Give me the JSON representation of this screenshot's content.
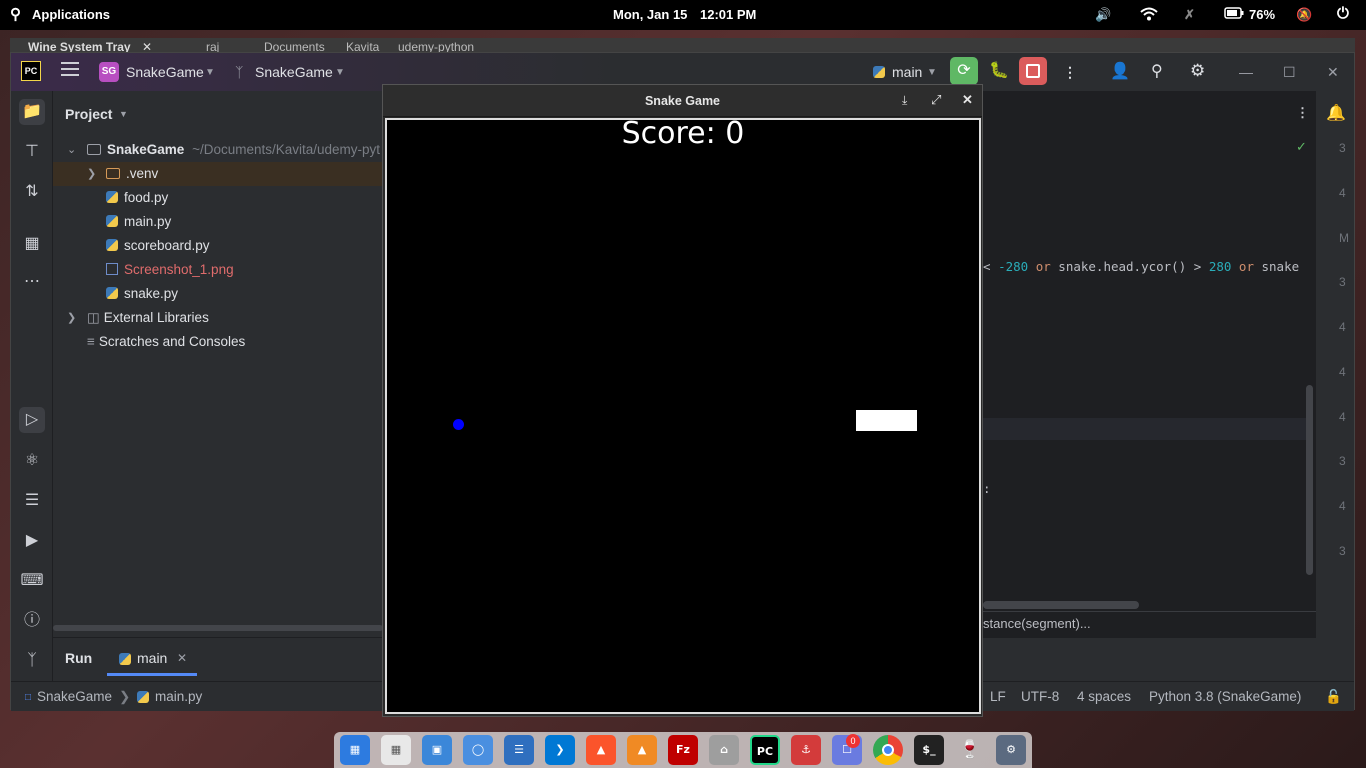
{
  "top_panel": {
    "applications_label": "Applications",
    "date": "Mon, Jan 15",
    "time": "12:01 PM",
    "battery": "76%"
  },
  "background_window": {
    "tab_title": "Wine System Tray",
    "breadcrumb": [
      "raj",
      "Documents",
      "Kavita",
      "udemy-python"
    ]
  },
  "ide": {
    "logo": "PC",
    "project_badge": "SG",
    "project_name": "SnakeGame",
    "vcs_project": "SnakeGame",
    "run_config": "main",
    "project_panel_title": "Project",
    "tree": {
      "root_name": "SnakeGame",
      "root_path": "~/Documents/Kavita/udemy-pyt",
      "items": [
        {
          "label": ".venv",
          "kind": "folder"
        },
        {
          "label": "food.py",
          "kind": "python"
        },
        {
          "label": "main.py",
          "kind": "python"
        },
        {
          "label": "scoreboard.py",
          "kind": "python"
        },
        {
          "label": "Screenshot_1.png",
          "kind": "image"
        },
        {
          "label": "snake.py",
          "kind": "python"
        }
      ],
      "external_libraries": "External Libraries",
      "scratches": "Scratches and Consoles"
    },
    "editor": {
      "code_line": "< -280 or snake.head.ycor() > 280 or snake",
      "num_a": "-280",
      "num_b": "280",
      "hint_line": "stance(segment)...",
      "colon_line": ":"
    },
    "gutter_digits": [
      "3",
      "4",
      "M",
      "3",
      "4",
      "4",
      "4",
      "3",
      "4",
      "3"
    ],
    "run_panel": {
      "title": "Run",
      "tab": "main"
    },
    "status_bar": {
      "breadcrumb_project": "SnakeGame",
      "breadcrumb_file": "main.py",
      "line_ending": "LF",
      "encoding": "UTF-8",
      "indent": "4 spaces",
      "interpreter": "Python 3.8 (SnakeGame)"
    }
  },
  "game_window": {
    "title": "Snake Game",
    "score_text": "Score: 0",
    "food_color": "#0000ff",
    "snake_color": "#ffffff"
  },
  "dock": {
    "apps": [
      "workspaces-icon",
      "calculator-icon",
      "image-viewer-icon",
      "settings-toggle-icon",
      "text-editor-icon",
      "vscode-icon",
      "brave-icon",
      "vlc-icon",
      "filezilla-icon",
      "files-icon",
      "pycharm-icon",
      "gitkraken-icon",
      "app-store-icon",
      "chrome-icon",
      "terminal-icon",
      "wine-icon",
      "system-settings-icon"
    ],
    "app_store_badge": "0",
    "pycharm_label": "PC",
    "terminal_label": "$_"
  },
  "colors": {
    "ide_bg": "#1e1f22",
    "panel_bg": "#2b2d30",
    "run_green": "#5fb865",
    "stop_red": "#db5c5c",
    "screenshot_file": "#e06c6c"
  }
}
